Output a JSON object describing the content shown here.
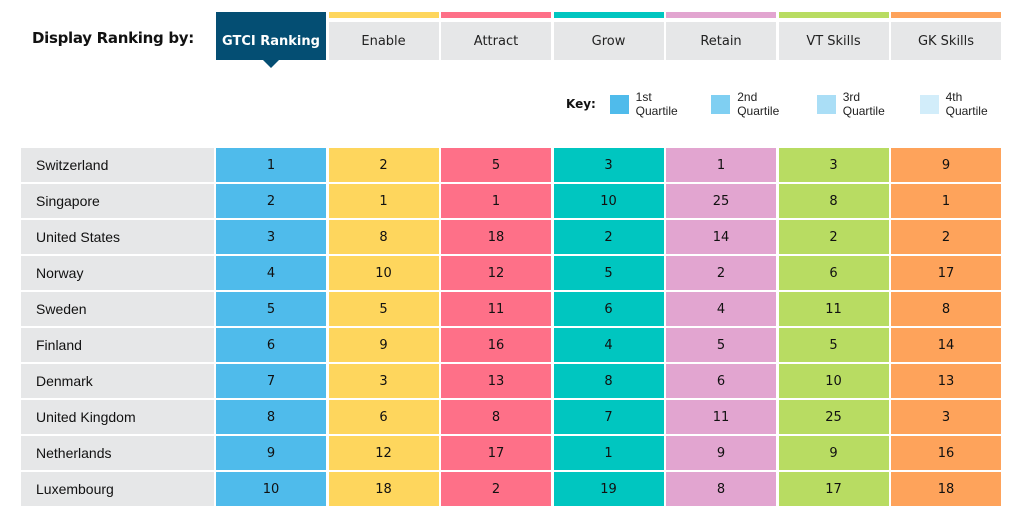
{
  "header": {
    "display_label": "Display Ranking by:",
    "tabs": [
      {
        "label": "GTCI Ranking",
        "color": "#044e73",
        "active": true
      },
      {
        "label": "Enable",
        "color": "#fed65d"
      },
      {
        "label": "Attract",
        "color": "#fe7088"
      },
      {
        "label": "Grow",
        "color": "#00c6c0"
      },
      {
        "label": "Retain",
        "color": "#e2a5d0"
      },
      {
        "label": "VT Skills",
        "color": "#b8dc62"
      },
      {
        "label": "GK Skills",
        "color": "#fea35b"
      }
    ]
  },
  "key": {
    "title": "Key:",
    "items": [
      {
        "label": "1st Quartile",
        "color": "#4fbbeb"
      },
      {
        "label": "2nd Quartile",
        "color": "#7fcff2"
      },
      {
        "label": "3rd Quartile",
        "color": "#aadef6"
      },
      {
        "label": "4th Quartile",
        "color": "#d2edfa"
      }
    ]
  },
  "column_colors": [
    "#4fbbeb",
    "#fed65d",
    "#fe7088",
    "#00c6c0",
    "#e2a5d0",
    "#b8dc62",
    "#fea35b"
  ],
  "rows": [
    {
      "country": "Switzerland",
      "values": [
        "1",
        "2",
        "5",
        "3",
        "1",
        "3",
        "9"
      ]
    },
    {
      "country": "Singapore",
      "values": [
        "2",
        "1",
        "1",
        "10",
        "25",
        "8",
        "1"
      ]
    },
    {
      "country": "United States",
      "values": [
        "3",
        "8",
        "18",
        "2",
        "14",
        "2",
        "2"
      ]
    },
    {
      "country": "Norway",
      "values": [
        "4",
        "10",
        "12",
        "5",
        "2",
        "6",
        "17"
      ]
    },
    {
      "country": "Sweden",
      "values": [
        "5",
        "5",
        "11",
        "6",
        "4",
        "11",
        "8"
      ]
    },
    {
      "country": "Finland",
      "values": [
        "6",
        "9",
        "16",
        "4",
        "5",
        "5",
        "14"
      ]
    },
    {
      "country": "Denmark",
      "values": [
        "7",
        "3",
        "13",
        "8",
        "6",
        "10",
        "13"
      ]
    },
    {
      "country": "United Kingdom",
      "values": [
        "8",
        "6",
        "8",
        "7",
        "11",
        "25",
        "3"
      ]
    },
    {
      "country": "Netherlands",
      "values": [
        "9",
        "12",
        "17",
        "1",
        "9",
        "9",
        "16"
      ]
    },
    {
      "country": "Luxembourg",
      "values": [
        "10",
        "18",
        "2",
        "19",
        "8",
        "17",
        "18"
      ]
    }
  ]
}
